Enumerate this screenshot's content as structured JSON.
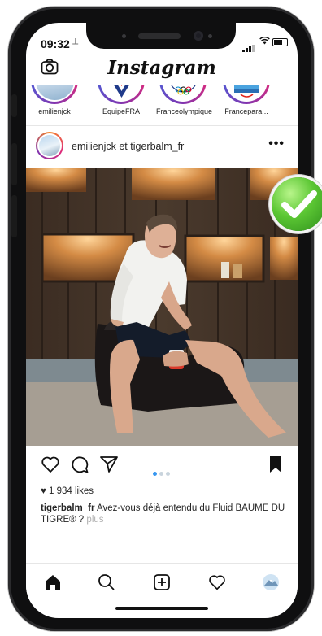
{
  "status": {
    "time": "09:32",
    "location_glyph": "⟂"
  },
  "app": {
    "title": "Instagram"
  },
  "stories": [
    {
      "name": "emilienjck"
    },
    {
      "name": "EquipeFRA"
    },
    {
      "name": "Franceolympique"
    },
    {
      "name": "Francepara..."
    }
  ],
  "post": {
    "author": "emilienjck et tigerbalm_fr",
    "more": "•••",
    "likes": "1 934 likes",
    "caption_user": "tigerbalm_fr",
    "caption_text": " Avez-vous déjà entendu du Fluid BAUME DU TIGRE® ?",
    "caption_more": "plus",
    "carousel_index": 1,
    "carousel_count": 3
  },
  "colors": {
    "accent": "#3897f0",
    "check_green": "#5cc734"
  },
  "icons": [
    "camera-icon",
    "heart-icon",
    "comment-icon",
    "share-icon",
    "bookmark-icon",
    "home-icon",
    "search-icon",
    "add-post-icon",
    "activity-icon",
    "profile-icon",
    "check-badge-icon"
  ]
}
